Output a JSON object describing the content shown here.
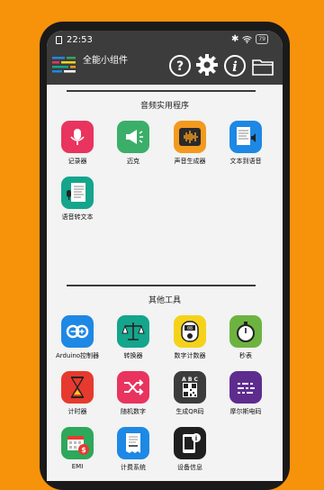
{
  "status": {
    "time": "22:53",
    "battery": "79"
  },
  "app": {
    "title": "全能小组件"
  },
  "sections": [
    {
      "title": "音频实用程序",
      "items": [
        {
          "label": "记录器",
          "icon": "microphone-icon",
          "color": "#E8345F"
        },
        {
          "label": "迈克",
          "icon": "megaphone-icon",
          "color": "#3BAE6A"
        },
        {
          "label": "声音生成器",
          "icon": "sound-wave-icon",
          "color": "#F39A1E"
        },
        {
          "label": "文本到语音",
          "icon": "document-speaker-icon",
          "color": "#1E88E5"
        },
        {
          "label": "语音转文本",
          "icon": "document-microphone-icon",
          "color": "#14A58C"
        }
      ]
    },
    {
      "title": "其他工具",
      "items": [
        {
          "label": "Arduino控制器",
          "icon": "arduino-icon",
          "color": "#1E88E5"
        },
        {
          "label": "转换器",
          "icon": "scale-icon",
          "color": "#14A58C"
        },
        {
          "label": "数字计数器",
          "icon": "counter-icon",
          "color": "#F5D21A"
        },
        {
          "label": "秒表",
          "icon": "stopwatch-icon",
          "color": "#6DB33F"
        },
        {
          "label": "计时器",
          "icon": "hourglass-icon",
          "color": "#E63A2E"
        },
        {
          "label": "随机数字",
          "icon": "shuffle-icon",
          "color": "#E8345F"
        },
        {
          "label": "生成QR码",
          "icon": "qr-code-icon",
          "color": "#3C3C3C"
        },
        {
          "label": "摩尔斯电码",
          "icon": "morse-code-icon",
          "color": "#5E2C8F"
        },
        {
          "label": "EMI",
          "icon": "calendar-money-icon",
          "color": "#2EA85A"
        },
        {
          "label": "计费系统",
          "icon": "receipt-icon",
          "color": "#1E88E5"
        },
        {
          "label": "设备信息",
          "icon": "phone-info-icon",
          "color": "#1F1F1F"
        }
      ]
    }
  ]
}
